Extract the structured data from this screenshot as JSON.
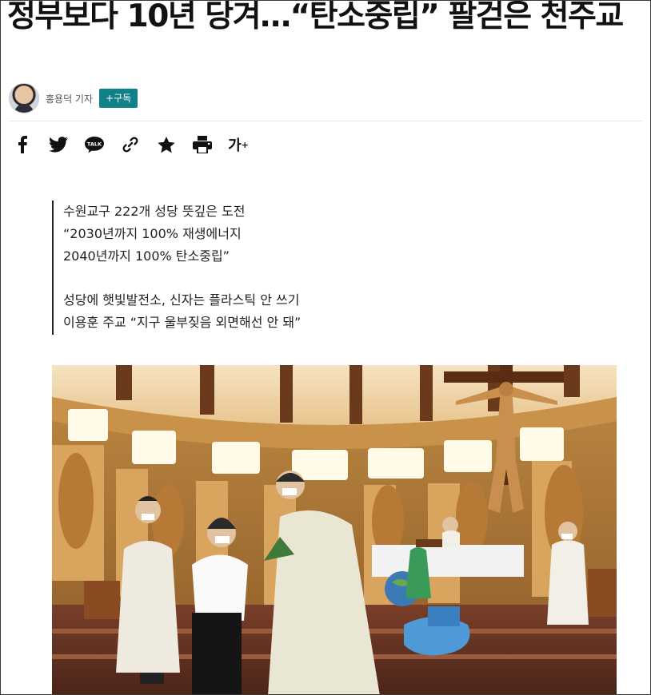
{
  "article": {
    "headline": "정부보다 10년 당겨…“탄소중립” 팔걷은 천주교",
    "author": "홍용덕 기자",
    "subscribe_label": "+구독"
  },
  "share_tools": {
    "icons": [
      "facebook-icon",
      "twitter-icon",
      "kakaotalk-icon",
      "link-icon",
      "bookmark-star-icon",
      "print-icon",
      "font-size-icon"
    ],
    "talk_label": "TALK",
    "font_size_label": "가",
    "font_size_plus": "+"
  },
  "summary": {
    "lines": [
      "수원교구 222개 성당 뜻깊은 도전",
      "“2030년까지 100% 재생에너지",
      "2040년까지 100% 탄소중립”",
      "",
      "성당에 햇빛발전소, 신자는 플라스틱 안 쓰기",
      "이용훈 주교 “지구 울부짖음 외면해선 안 돼”"
    ]
  },
  "colors": {
    "subscribe_bg": "#108089",
    "text": "#111111"
  }
}
